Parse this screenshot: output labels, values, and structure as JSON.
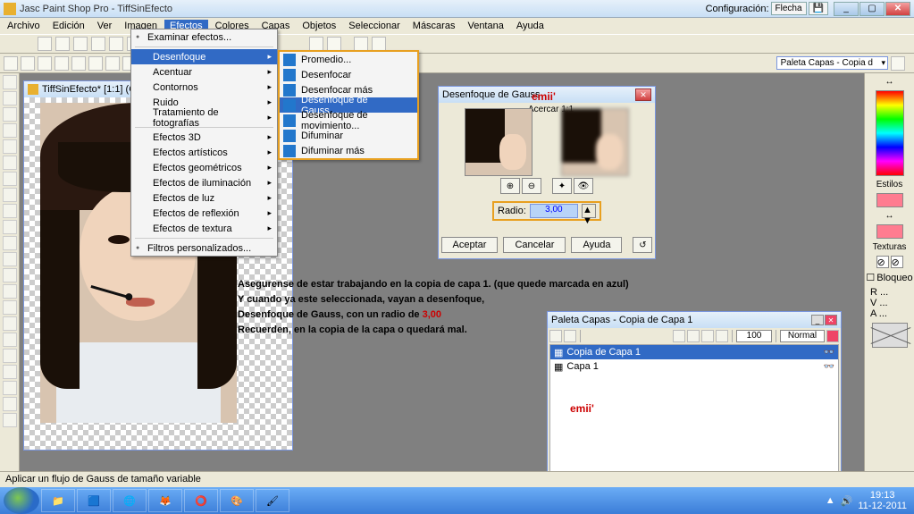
{
  "app": {
    "title": "Jasc Paint Shop Pro - TiffSinEfecto"
  },
  "config": {
    "label": "Configuración:",
    "value": "Flecha"
  },
  "menubar": [
    "Archivo",
    "Edición",
    "Ver",
    "Imagen",
    "Efectos",
    "Colores",
    "Capas",
    "Objetos",
    "Seleccionar",
    "Máscaras",
    "Ventana",
    "Ayuda"
  ],
  "toolbar2_combo": "Paleta Capas - Copia d",
  "doc": {
    "title": "TiffSinEfecto* [1:1] (Copi..."
  },
  "menu1": {
    "examine": "Examinar efectos...",
    "items1": [
      {
        "l": "Desenfoque",
        "hl": true
      },
      {
        "l": "Acentuar"
      },
      {
        "l": "Contornos"
      },
      {
        "l": "Ruido"
      },
      {
        "l": "Tratamiento de fotografías"
      }
    ],
    "items2": [
      {
        "l": "Efectos 3D"
      },
      {
        "l": "Efectos artísticos"
      },
      {
        "l": "Efectos geométricos"
      },
      {
        "l": "Efectos de iluminación"
      },
      {
        "l": "Efectos de luz"
      },
      {
        "l": "Efectos de reflexión"
      },
      {
        "l": "Efectos de textura"
      }
    ],
    "custom": "Filtros personalizados..."
  },
  "menu2": [
    {
      "l": "Promedio..."
    },
    {
      "l": "Desenfocar"
    },
    {
      "l": "Desenfocar más"
    },
    {
      "l": "Desenfoque de Gauss...",
      "hl": true
    },
    {
      "l": "Desenfoque de movimiento..."
    },
    {
      "l": "Difuminar"
    },
    {
      "l": "Difuminar más"
    }
  ],
  "dialog": {
    "title": "Desenfoque de Gauss",
    "sig": "emii'",
    "zoom": "Acercar 1:1",
    "radio_label": "Radio:",
    "radio_value": "3,00",
    "b1": "Aceptar",
    "b2": "Cancelar",
    "b3": "Ayuda"
  },
  "layers": {
    "title": "Paleta Capas - Copia de Capa 1",
    "opacity1": "100",
    "mode1": "Normal",
    "opacity2": "100",
    "mode2": "Normal",
    "r1": "Copia de Capa 1",
    "r2": "Capa 1",
    "sig": "emii'"
  },
  "instructions": {
    "l1a": "Asegurense de estar trabajando en la copia de capa 1. (que quede marcada en azul)",
    "l2a": "Y cuando ya este seleccionada, vayan a desenfoque,",
    "l3a": "Desenfoque de Gauss, con un radio de ",
    "l3b": "3,00",
    "l4a": "Recuerden, en la copia de la capa o quedará mal."
  },
  "status": "Aplicar un flujo de Gauss de tamaño variable",
  "right": {
    "styles": "Estilos",
    "textures": "Texturas",
    "lock": "Bloqueo",
    "r": "R",
    "v": "V",
    "a": "A",
    "dots": "..."
  },
  "clock": {
    "time": "19:13",
    "date": "11-12-2011"
  }
}
